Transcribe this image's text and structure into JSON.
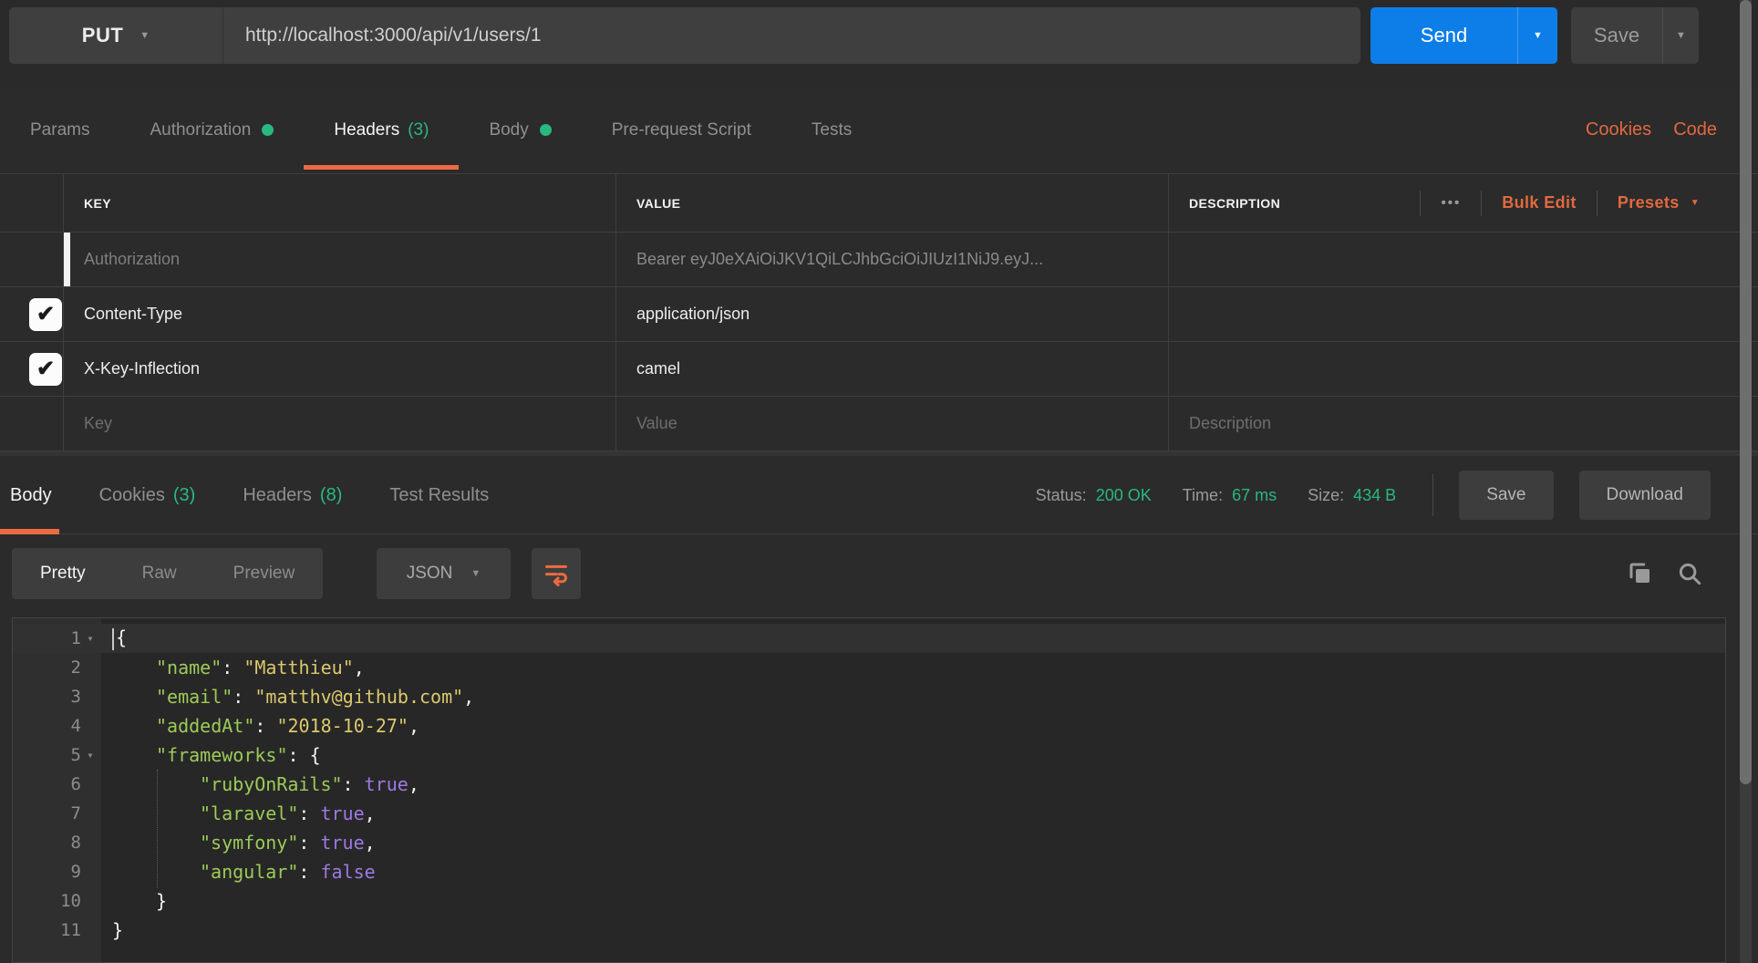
{
  "icons": {
    "caret_down": "▼",
    "check": "✔",
    "dots": "•••",
    "fold": "▾"
  },
  "colors": {
    "accent_orange": "#ED6B40",
    "green": "#29B87F",
    "blue": "#0D7EE8"
  },
  "topbar": {
    "method": "PUT",
    "url": "http://localhost:3000/api/v1/users/1",
    "send": "Send",
    "save": "Save"
  },
  "request_tabs": {
    "params": "Params",
    "authorization": "Authorization",
    "headers": "Headers",
    "headers_count": "(3)",
    "body": "Body",
    "prerequest": "Pre-request Script",
    "tests": "Tests",
    "cookies_link": "Cookies",
    "code_link": "Code"
  },
  "headers_table": {
    "col_key": "KEY",
    "col_value": "VALUE",
    "col_description": "DESCRIPTION",
    "bulk_edit": "Bulk Edit",
    "presets": "Presets",
    "rows": [
      {
        "key": "Authorization",
        "value": "Bearer eyJ0eXAiOiJKV1QiLCJhbGciOiJIUzI1NiJ9.eyJ..."
      },
      {
        "key": "Content-Type",
        "value": "application/json"
      },
      {
        "key": "X-Key-Inflection",
        "value": "camel"
      }
    ],
    "placeholder_key": "Key",
    "placeholder_value": "Value",
    "placeholder_description": "Description"
  },
  "response": {
    "tab_body": "Body",
    "tab_cookies": "Cookies",
    "cookies_count": "(3)",
    "tab_headers": "Headers",
    "headers_count": "(8)",
    "tab_tests": "Test Results",
    "status_label": "Status:",
    "status": "200 OK",
    "time_label": "Time:",
    "time": "67 ms",
    "size_label": "Size:",
    "size": "434 B",
    "save": "Save",
    "download": "Download",
    "view_pretty": "Pretty",
    "view_raw": "Raw",
    "view_preview": "Preview",
    "format": "JSON"
  },
  "code": {
    "lines": [
      {
        "num": "1",
        "open": "{"
      },
      {
        "num": "2",
        "key": "\"name\"",
        "colon": ": ",
        "value": "\"Matthieu\"",
        "comma": ","
      },
      {
        "num": "3",
        "key": "\"email\"",
        "colon": ": ",
        "value": "\"matthv@github.com\"",
        "comma": ","
      },
      {
        "num": "4",
        "key": "\"addedAt\"",
        "colon": ": ",
        "value": "\"2018-10-27\"",
        "comma": ","
      },
      {
        "num": "5",
        "key": "\"frameworks\"",
        "colon": ": ",
        "open": "{"
      },
      {
        "num": "6",
        "key": "\"rubyOnRails\"",
        "colon": ": ",
        "value": "true",
        "comma": ","
      },
      {
        "num": "7",
        "key": "\"laravel\"",
        "colon": ": ",
        "value": "true",
        "comma": ","
      },
      {
        "num": "8",
        "key": "\"symfony\"",
        "colon": ": ",
        "value": "true",
        "comma": ","
      },
      {
        "num": "9",
        "key": "\"angular\"",
        "colon": ": ",
        "value": "false"
      },
      {
        "num": "10",
        "close": "}"
      },
      {
        "num": "11",
        "close": "}"
      }
    ]
  }
}
